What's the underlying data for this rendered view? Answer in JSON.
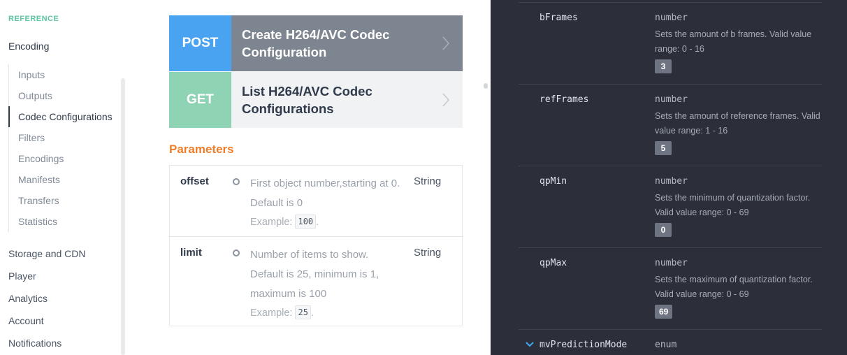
{
  "sidebar": {
    "reference_label": "REFERENCE",
    "section_title": "Encoding",
    "subnav": [
      {
        "label": "Inputs"
      },
      {
        "label": "Outputs"
      },
      {
        "label": "Codec Configurations",
        "active": true
      },
      {
        "label": "Filters"
      },
      {
        "label": "Encodings"
      },
      {
        "label": "Manifests"
      },
      {
        "label": "Transfers"
      },
      {
        "label": "Statistics"
      }
    ],
    "main_nav": [
      {
        "label": "Storage and CDN"
      },
      {
        "label": "Player"
      },
      {
        "label": "Analytics"
      },
      {
        "label": "Account"
      },
      {
        "label": "Notifications"
      }
    ]
  },
  "endpoints": [
    {
      "method": "POST",
      "title": "Create H264/AVC Codec Configuration"
    },
    {
      "method": "GET",
      "title": "List H264/AVC Codec Configurations"
    }
  ],
  "parameters": {
    "title": "Parameters",
    "rows": [
      {
        "name": "offset",
        "description": "First object number,starting at 0. Default is 0",
        "example_label": "Example:",
        "example_value": "100",
        "example_suffix": ".",
        "type": "String"
      },
      {
        "name": "limit",
        "description": "Number of items to show. Default is 25, minimum is 1, maximum is 100",
        "example_label": "Example:",
        "example_value": "25",
        "example_suffix": ".",
        "type": "String"
      }
    ]
  },
  "schema_fields": [
    {
      "name": "bFrames",
      "type": "number",
      "description": "Sets the amount of b frames. Valid value range: 0 - 16",
      "badge": "3"
    },
    {
      "name": "refFrames",
      "type": "number",
      "description": "Sets the amount of reference frames. Valid value range: 1 - 16",
      "badge": "5"
    },
    {
      "name": "qpMin",
      "type": "number",
      "description": "Sets the minimum of quantization factor. Valid value range: 0 - 69",
      "badge": "0"
    },
    {
      "name": "qpMax",
      "type": "number",
      "description": "Sets the maximum of quantization factor. Valid value range: 0 - 69",
      "badge": "69"
    },
    {
      "name": "mvPredictionMode",
      "type": "enum"
    }
  ],
  "icons": {
    "chevron_right": "chevron-right-icon",
    "param_marker": "circle-outline-icon",
    "expand": "chevron-down-icon"
  },
  "colors": {
    "reference_label": "#5ec4a4",
    "post": "#4aa3f0",
    "get": "#8fd3b5",
    "parameters_title": "#ef7d28",
    "dark_panel": "#2c2f3a",
    "expand_icon": "#3fa9f5"
  }
}
